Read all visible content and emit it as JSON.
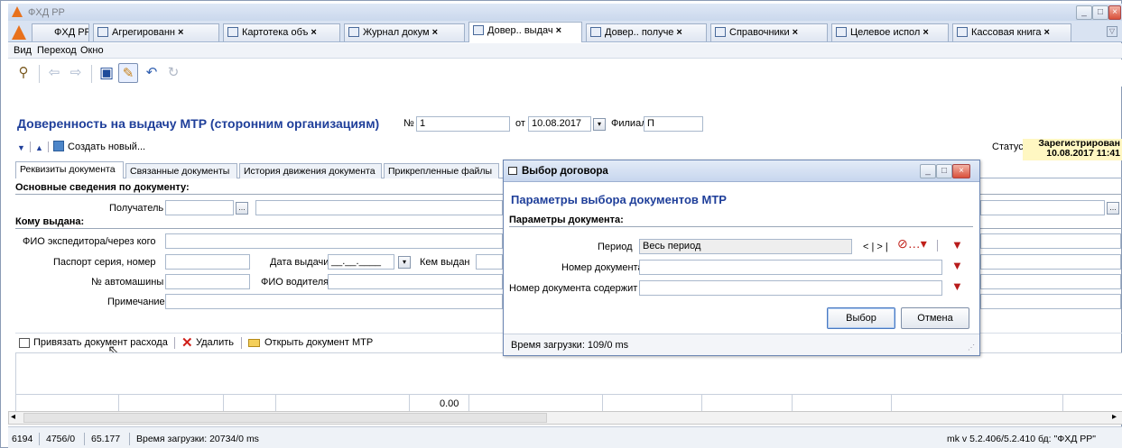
{
  "window": {
    "title": "ФХД PP"
  },
  "tabs": [
    {
      "label": "ФХД PP",
      "close": ""
    },
    {
      "label": "Агрегированн",
      "close": "×"
    },
    {
      "label": "Картотека объ",
      "close": "×"
    },
    {
      "label": "Журнал докум",
      "close": "×"
    },
    {
      "label": "Довер.. выдач",
      "close": "×"
    },
    {
      "label": "Довер.. получе",
      "close": "×"
    },
    {
      "label": "Справочники",
      "close": "×"
    },
    {
      "label": "Целевое испол",
      "close": "×"
    },
    {
      "label": "Кассовая книга",
      "close": "×"
    }
  ],
  "menu": {
    "view": "Вид",
    "navigate": "Переход",
    "window": "Окно"
  },
  "document": {
    "title": "Доверенность на выдачу МТР (сторонним организациям)",
    "number_label": "№",
    "number": "1",
    "date_label": "от",
    "date": "10.08.2017",
    "branch_label": "Филиал",
    "branch": "П",
    "create_new": "Создать новый...",
    "status_label": "Статус:",
    "status_value": "Зарегистрирован",
    "status_time": "10.08.2017 11:41"
  },
  "doc_tabs": [
    "Реквизиты документа",
    "Связанные документы",
    "История движения документа",
    "Прикрепленные файлы"
  ],
  "form": {
    "section_main": "Основные сведения по документу:",
    "recipient_label": "Получатель",
    "section_issued": "Кому выдана:",
    "forwarder_label": "ФИО экспедитора/через кого",
    "passport_label": "Паспорт серия, номер",
    "issue_date_label": "Дата выдачи",
    "issue_date_value": "__.__.____",
    "issued_by_label": "Кем выдан",
    "car_label": "№ автомашины",
    "driver_label": "ФИО водителя",
    "note_label": "Примечание"
  },
  "actions": {
    "attach": "Привязать документ расхода",
    "delete": "Удалить",
    "open": "Открыть документ МТР"
  },
  "grid": {
    "total": "0.00"
  },
  "status": {
    "a": "6194",
    "b": "4756/0",
    "c": "65.177",
    "load": "Время загрузки: 20734/0 ms",
    "version": "mk v 5.2.406/5.2.410 бд: \"ФХД PP\""
  },
  "dialog": {
    "title": "Выбор договора",
    "heading": "Параметры выбора документов МТР",
    "section": "Параметры документа:",
    "period_label": "Период",
    "period_value": "Весь период",
    "period_controls": "< | > |",
    "docnum_label": "Номер документа",
    "docnum_contains_label": "Номер документа содержит",
    "select": "Выбор",
    "cancel": "Отмена",
    "load_time": "Время загрузки: 109/0 ms"
  },
  "colors": {
    "title_blue": "#1f3f9a",
    "status_yellow": "#fff7c2",
    "close_red": "#d9503a"
  }
}
